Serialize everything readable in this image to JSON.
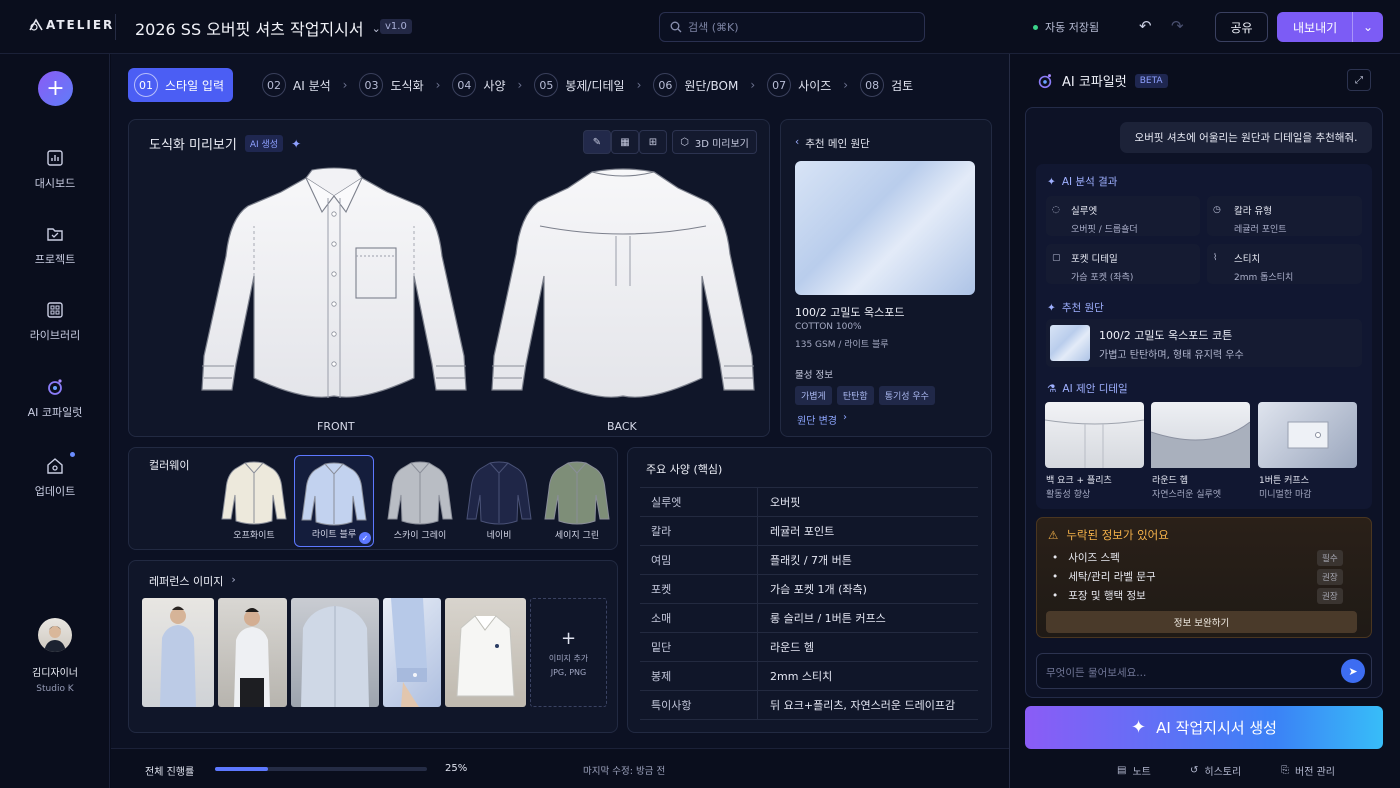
{
  "app": {
    "logo": "ATELIER"
  },
  "header": {
    "doc_title": "2026 SS 오버핏 셔츠 작업지시서",
    "version": "v1.0",
    "search_placeholder": "검색 (⌘K)",
    "autosave": "자동 저장됨",
    "share": "공유",
    "export": "내보내기"
  },
  "sidebar": {
    "items": [
      {
        "label": "대시보드",
        "icon": "dashboard-icon"
      },
      {
        "label": "프로젝트",
        "icon": "folder-icon"
      },
      {
        "label": "라이브러리",
        "icon": "library-icon"
      },
      {
        "label": "AI 코파일럿",
        "icon": "copilot-icon"
      },
      {
        "label": "업데이트",
        "icon": "update-icon"
      }
    ],
    "user": {
      "name": "김디자이너",
      "studio": "Studio K"
    }
  },
  "steps": [
    {
      "num": "01",
      "label": "스타일 입력",
      "active": true
    },
    {
      "num": "02",
      "label": "AI 분석"
    },
    {
      "num": "03",
      "label": "도식화"
    },
    {
      "num": "04",
      "label": "사양"
    },
    {
      "num": "05",
      "label": "봉제/디테일"
    },
    {
      "num": "06",
      "label": "원단/BOM"
    },
    {
      "num": "07",
      "label": "사이즈"
    },
    {
      "num": "08",
      "label": "검토"
    }
  ],
  "preview": {
    "title": "도식화 미리보기",
    "ai_tag": "AI 생성",
    "btn_3d": "3D 미리보기",
    "front": "FRONT",
    "back": "BACK"
  },
  "fabric": {
    "header": "추천 메인 원단",
    "name": "100/2 고밀도 옥스포드",
    "composition": "COTTON 100%",
    "spec": "135 GSM / 라이트 블루",
    "props_title": "물성 정보",
    "chips": [
      "가볍게",
      "탄탄함",
      "통기성 우수"
    ],
    "change": "원단 변경"
  },
  "colorway": {
    "title": "컬러웨이",
    "items": [
      {
        "label": "오프화이트",
        "color": "#ede9dc"
      },
      {
        "label": "라이트 블루",
        "color": "#c2d2ef",
        "selected": true
      },
      {
        "label": "스카이 그레이",
        "color": "#b9bdc4"
      },
      {
        "label": "네이비",
        "color": "#1f2647"
      },
      {
        "label": "세이지 그린",
        "color": "#7e8e78"
      }
    ]
  },
  "reference": {
    "title": "레퍼런스 이미지",
    "add": "이미지 추가",
    "formats": "JPG, PNG"
  },
  "specs": {
    "title": "주요 사양 (핵심)",
    "rows": [
      {
        "k": "실루엣",
        "v": "오버핏"
      },
      {
        "k": "칼라",
        "v": "레귤러 포인트"
      },
      {
        "k": "여밈",
        "v": "플래킷 / 7개 버튼"
      },
      {
        "k": "포켓",
        "v": "가슴 포켓 1개 (좌측)"
      },
      {
        "k": "소매",
        "v": "롱 슬리브 / 1버튼 커프스"
      },
      {
        "k": "밑단",
        "v": "라운드 헴"
      },
      {
        "k": "봉제",
        "v": "2mm 스티치"
      },
      {
        "k": "특이사항",
        "v": "뒤 요크+플리츠, 자연스러운 드레이프감"
      }
    ]
  },
  "progress": {
    "label": "전체 진행률",
    "value": 25,
    "text": "25%",
    "modified": "마지막 수정: 방금 전"
  },
  "copilot": {
    "title": "AI 코파일럿",
    "beta": "BETA",
    "user_msg": "오버핏 셔츠에 어울리는 원단과 디테일을 추천해줘.",
    "analysis_title": "AI 분석 결과",
    "analysis": [
      {
        "k": "실루엣",
        "v": "오버핏 / 드롭숄더"
      },
      {
        "k": "칼라 유형",
        "v": "레귤러 포인트"
      },
      {
        "k": "포켓 디테일",
        "v": "가슴 포켓 (좌측)"
      },
      {
        "k": "스티치",
        "v": "2mm 톱스티치"
      }
    ],
    "fabric_title": "추천 원단",
    "fabric_name": "100/2 고밀도 옥스포드 코튼",
    "fabric_desc": "가볍고 탄탄하며, 형태 유지력 우수",
    "detail_title": "AI 제안 디테일",
    "details": [
      {
        "name": "백 요크 + 플리츠",
        "desc": "활동성 향상"
      },
      {
        "name": "라운드 헴",
        "desc": "자연스러운 실루엣"
      },
      {
        "name": "1버튼 커프스",
        "desc": "미니멀한 마감"
      }
    ],
    "warn_title": "누락된 정보가 있어요",
    "warn_items": [
      {
        "label": "사이즈 스펙",
        "badge": "필수"
      },
      {
        "label": "세탁/관리 라벨 문구",
        "badge": "권장"
      },
      {
        "label": "포장 및 행택 정보",
        "badge": "권장"
      }
    ],
    "warn_btn": "정보 보완하기",
    "input_placeholder": "무엇이든 물어보세요...",
    "generate": "AI 작업지시서 생성",
    "footer": [
      "노트",
      "히스토리",
      "버전 관리"
    ]
  }
}
